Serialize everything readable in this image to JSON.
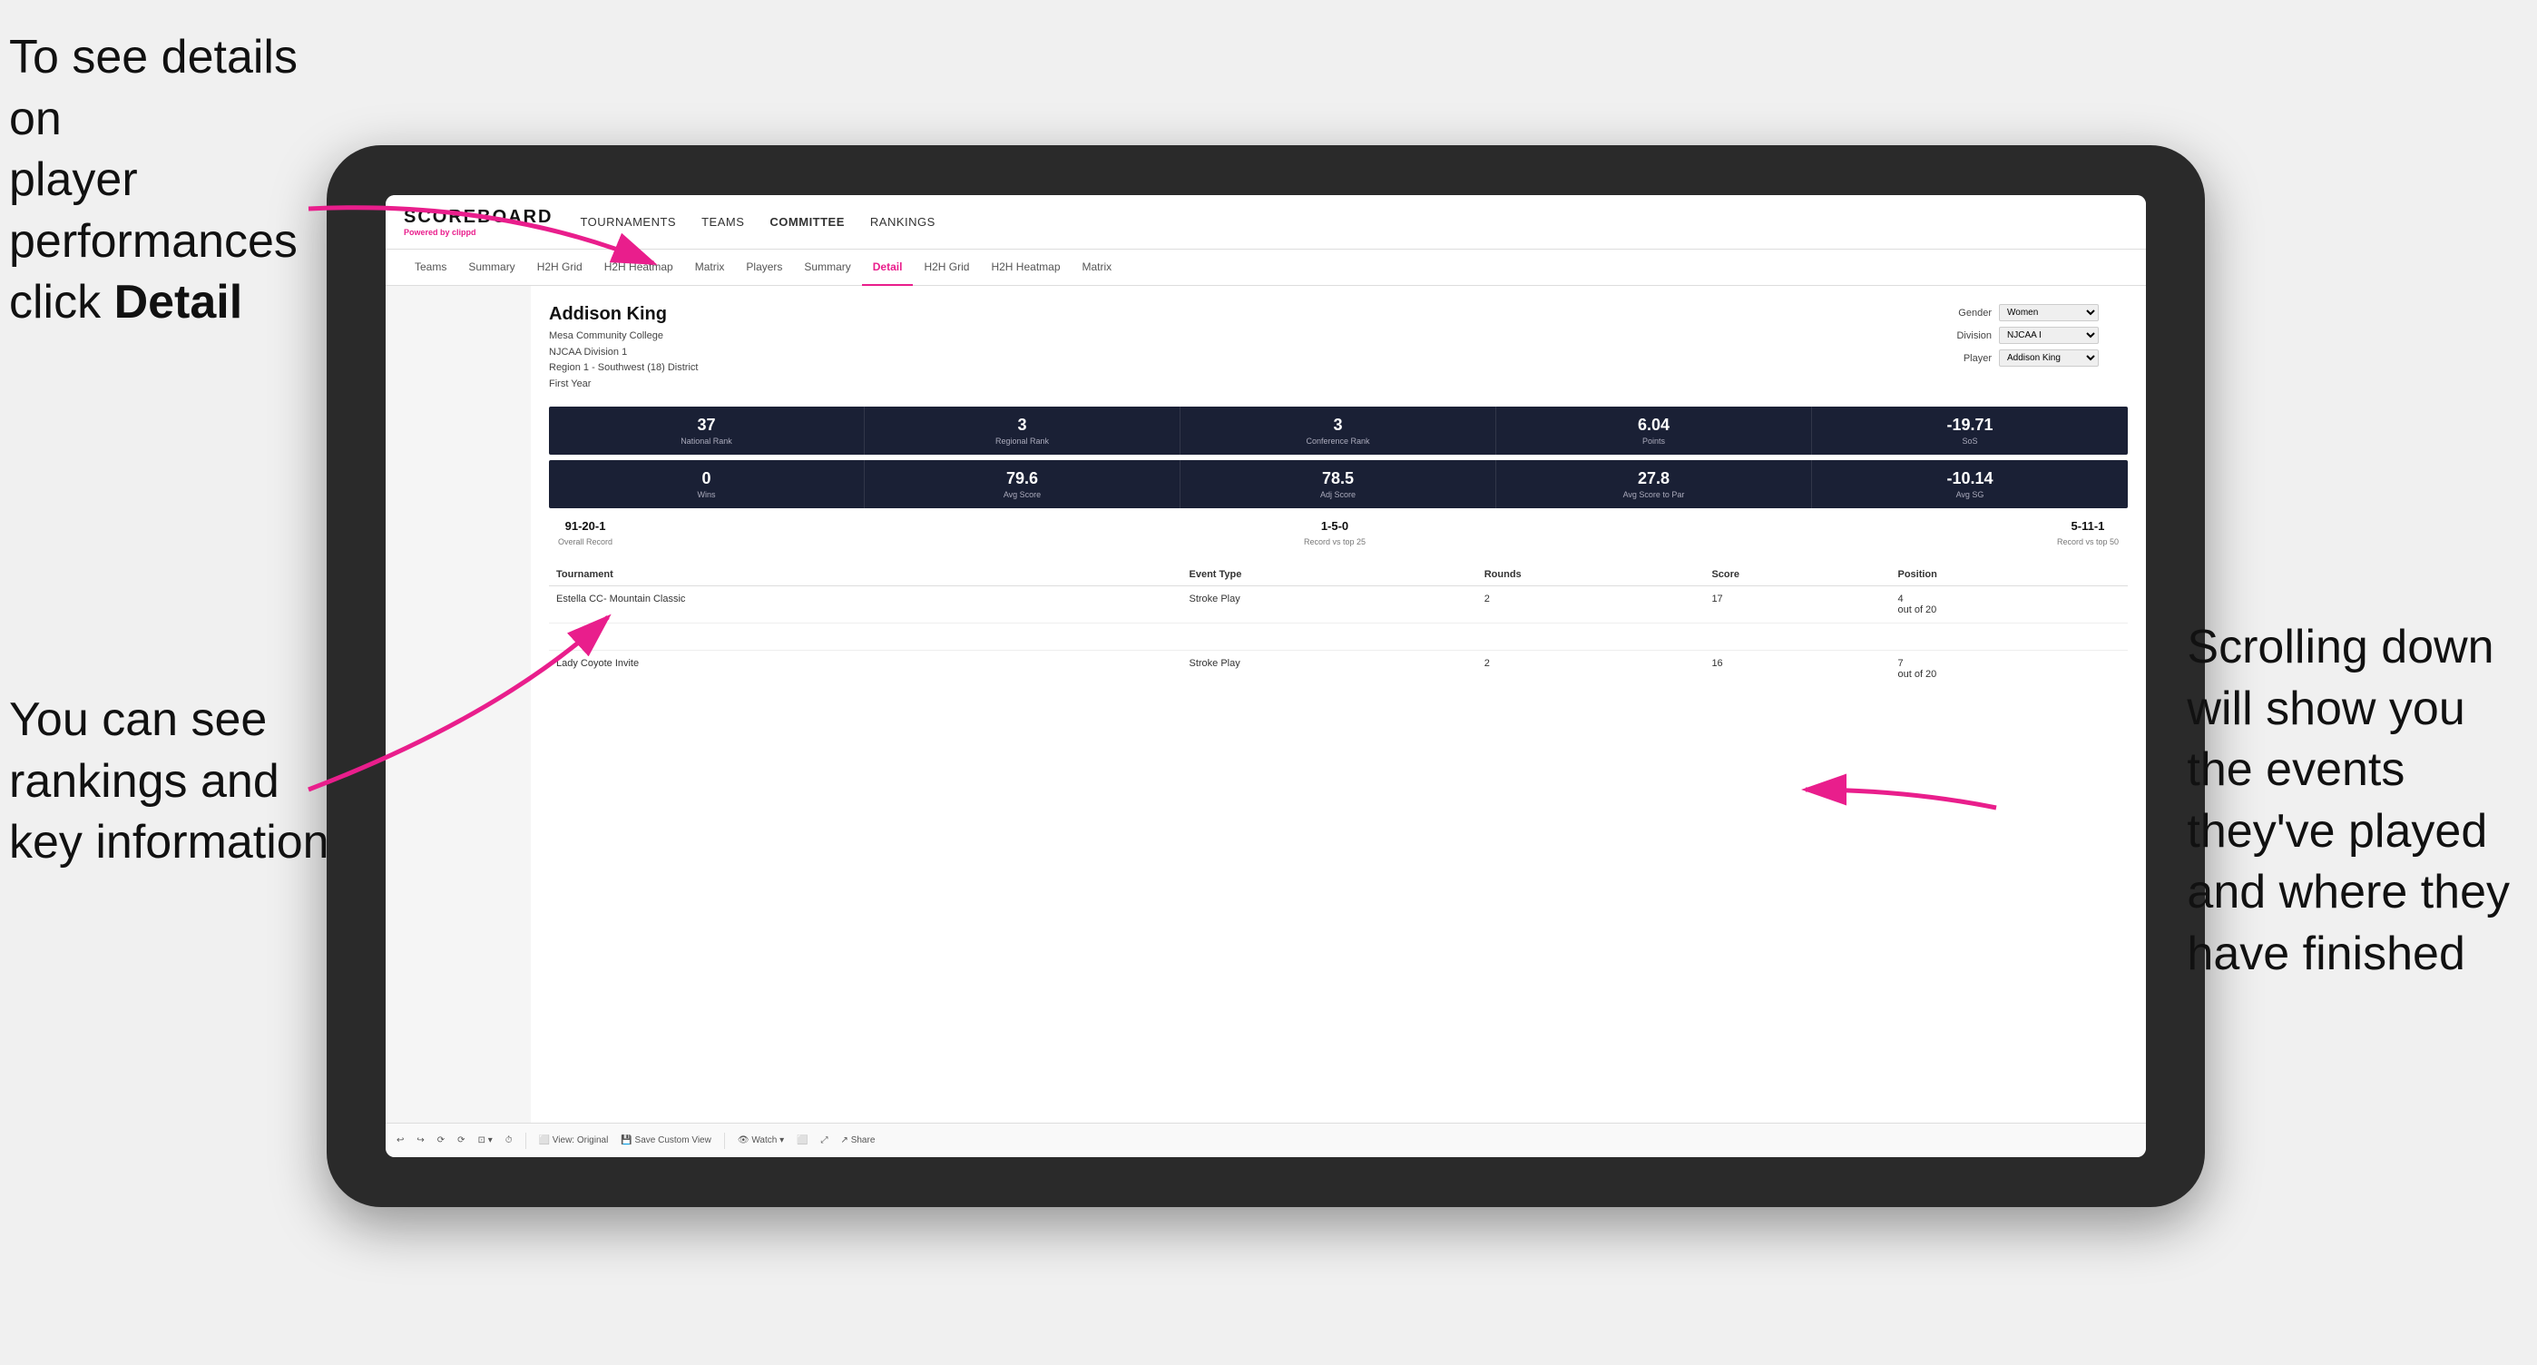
{
  "annotations": {
    "top_left_line1": "To see details on",
    "top_left_line2": "player performances",
    "top_left_line3": "click ",
    "top_left_bold": "Detail",
    "bottom_left_line1": "You can see",
    "bottom_left_line2": "rankings and",
    "bottom_left_line3": "key information",
    "right_line1": "Scrolling down",
    "right_line2": "will show you",
    "right_line3": "the events",
    "right_line4": "they've played",
    "right_line5": "and where they",
    "right_line6": "have finished"
  },
  "nav": {
    "logo": "SCOREBOARD",
    "powered_by": "Powered by ",
    "powered_brand": "clippd",
    "menu": [
      "TOURNAMENTS",
      "TEAMS",
      "COMMITTEE",
      "RANKINGS"
    ]
  },
  "sub_nav": {
    "tabs": [
      "Teams",
      "Summary",
      "H2H Grid",
      "H2H Heatmap",
      "Matrix",
      "Players",
      "Summary",
      "Detail",
      "H2H Grid",
      "H2H Heatmap",
      "Matrix"
    ],
    "active": "Detail"
  },
  "player": {
    "name": "Addison King",
    "college": "Mesa Community College",
    "division": "NJCAA Division 1",
    "region": "Region 1 - Southwest (18) District",
    "year": "First Year"
  },
  "filters": {
    "gender_label": "Gender",
    "gender_value": "Women",
    "division_label": "Division",
    "division_value": "NJCAA I",
    "player_label": "Player",
    "player_value": "Addison King"
  },
  "stats_row1": [
    {
      "value": "37",
      "label": "National Rank"
    },
    {
      "value": "3",
      "label": "Regional Rank"
    },
    {
      "value": "3",
      "label": "Conference Rank"
    },
    {
      "value": "6.04",
      "label": "Points"
    },
    {
      "value": "-19.71",
      "label": "SoS"
    }
  ],
  "stats_row2": [
    {
      "value": "0",
      "label": "Wins"
    },
    {
      "value": "79.6",
      "label": "Avg Score"
    },
    {
      "value": "78.5",
      "label": "Adj Score"
    },
    {
      "value": "27.8",
      "label": "Avg Score to Par"
    },
    {
      "value": "-10.14",
      "label": "Avg SG"
    }
  ],
  "records": [
    {
      "value": "91-20-1",
      "label": "Overall Record"
    },
    {
      "value": "1-5-0",
      "label": "Record vs top 25"
    },
    {
      "value": "5-11-1",
      "label": "Record vs top 50"
    }
  ],
  "table": {
    "headers": [
      "Tournament",
      "Event Type",
      "Rounds",
      "Score",
      "Position"
    ],
    "rows": [
      {
        "tournament": "Estella CC- Mountain Classic",
        "event_type": "Stroke Play",
        "rounds": "2",
        "score": "17",
        "position": "4 out of 20"
      },
      {
        "tournament": "Lady Coyote Invite",
        "event_type": "Stroke Play",
        "rounds": "2",
        "score": "16",
        "position": "7 out of 20"
      }
    ]
  },
  "toolbar": {
    "buttons": [
      "↩",
      "↪",
      "⟳",
      "⟳",
      "⊡ ▾",
      "⏱",
      "View: Original",
      "Save Custom View",
      "Watch ▾",
      "⬜",
      "⤢",
      "Share"
    ]
  }
}
